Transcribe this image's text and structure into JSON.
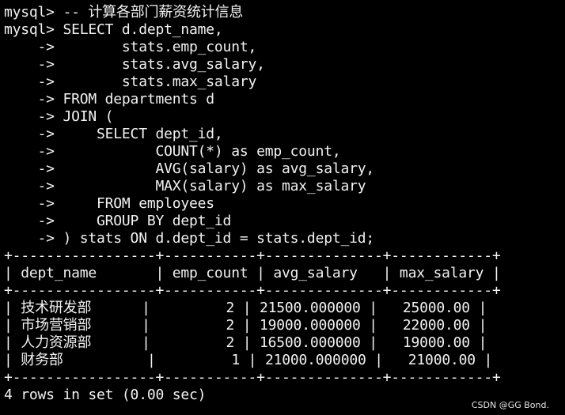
{
  "terminal": {
    "lines": [
      "mysql> -- 计算各部门薪资统计信息",
      "mysql> SELECT d.dept_name,",
      "    ->        stats.emp_count,",
      "    ->        stats.avg_salary,",
      "    ->        stats.max_salary",
      "    -> FROM departments d",
      "    -> JOIN (",
      "    ->     SELECT dept_id,",
      "    ->            COUNT(*) as emp_count,",
      "    ->            AVG(salary) as avg_salary,",
      "    ->            MAX(salary) as max_salary",
      "    ->     FROM employees",
      "    ->     GROUP BY dept_id",
      "    -> ) stats ON d.dept_id = stats.dept_id;",
      "+-----------------+-----------+--------------+------------+",
      "| dept_name       | emp_count | avg_salary   | max_salary |",
      "+-----------------+-----------+--------------+------------+",
      "| 技术研发部      |         2 | 21500.000000 |   25000.00 |",
      "| 市场营销部      |         2 | 19000.000000 |   22000.00 |",
      "| 人力资源部      |         2 | 16500.000000 |   19000.00 |",
      "| 财务部          |         1 | 21000.000000 |   21000.00 |",
      "+-----------------+-----------+--------------+------------+",
      "4 rows in set (0.00 sec)"
    ]
  },
  "watermark": "CSDN @GG Bond."
}
